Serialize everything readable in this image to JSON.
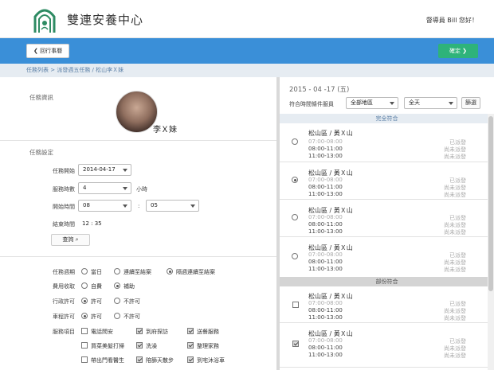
{
  "header": {
    "app_title": "雙連安養中心",
    "greeting": "督導員 Bill 您好！"
  },
  "toolbar": {
    "back_label": "回行事曆",
    "confirm_label": "確定"
  },
  "breadcrumb": "任務列表 > 派發週五任務 / 松山李Ｘ妹",
  "task_info": {
    "section_label": "任務資訊",
    "person_name": "李Ｘ妹"
  },
  "task_settings": {
    "section_label": "任務設定",
    "start_label": "任務開始",
    "start_value": "2014-04-17",
    "hours_label": "服務時數",
    "hours_value": "4",
    "hours_unit": "小時",
    "time_label": "開始時間",
    "time_hour": "08",
    "time_sep": ":",
    "time_minute": "05",
    "end_label": "結束時間",
    "end_value": "12 : 35",
    "search_label": "查詢"
  },
  "options": {
    "cycle_label": "任務週期",
    "cycle_opts": [
      "當日",
      "連續至結案",
      "隔週連續至結案"
    ],
    "fee_label": "費用收取",
    "fee_opts": [
      "自費",
      "補助"
    ],
    "admin_label": "行政許可",
    "admin_opts": [
      "許可",
      "不許可"
    ],
    "car_label": "車程許可",
    "car_opts": [
      "許可",
      "不許可"
    ],
    "service_label": "服務項目",
    "service_items": [
      "電話問安",
      "到府探訪",
      "送餐服務",
      "買菜美髮打掃",
      "洗澡",
      "整理家務",
      "帶出門看醫生",
      "陪篩天散步",
      "到宅沐浴車"
    ]
  },
  "right": {
    "date_title": "2015 - 04 -17 (五)",
    "filter_label": "符合時間條件服員",
    "region_value": "全部地區",
    "day_value": "全天",
    "filter_button": "篩選",
    "group_full": "完全符合",
    "group_partial": "部份符合",
    "card_title": "松山區 / 黃Ｘ山",
    "time1": "07:00-08:00",
    "time2": "08:00-11:00",
    "time3": "11:00-13:00",
    "stat1": "已派發",
    "stat2": "尚未派發",
    "stat3": "尚未派發"
  },
  "colors": {
    "blue": "#3a8fd8",
    "green": "#2eb37a",
    "full_group_bg": "#e6ecf2",
    "partial_group_bg": "#d4d4d4"
  }
}
